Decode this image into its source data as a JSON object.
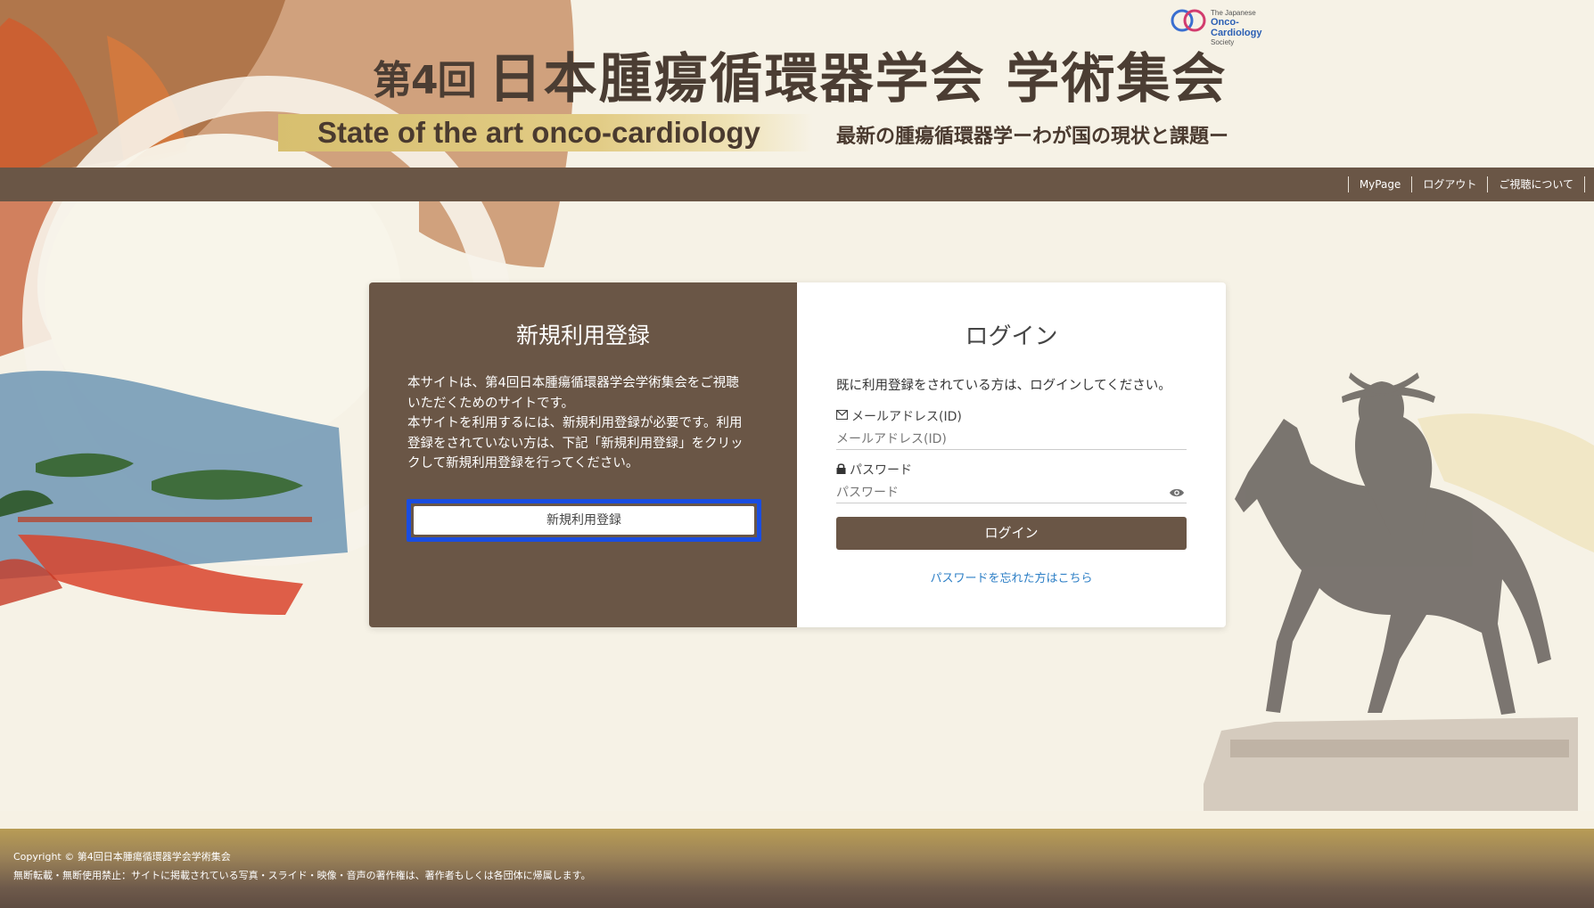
{
  "header": {
    "society_logo": {
      "line1": "The Japanese",
      "line2": "Onco-Cardiology",
      "line3": "Society",
      "icon": "society-ring-logo"
    },
    "title_number": "第4回",
    "title_name": "日本腫瘍循環器学会 学術集会",
    "subtitle_en": "State of the art onco-cardiology",
    "subtitle_jp": "最新の腫瘍循環器学ーわが国の現状と課題ー"
  },
  "nav": {
    "links": [
      "MyPage",
      "ログアウト",
      "ご視聴について"
    ]
  },
  "register": {
    "title": "新規利用登録",
    "body": "本サイトは、第4回日本腫瘍循環器学会学術集会をご視聴いただくためのサイトです。本サイトを利用するには、新規利用登録が必要です。利用登録をされていない方は、下記「新規利用登録」をクリックして新規利用登録を行ってください。",
    "body_lines": [
      "本サイトは、第4回日本腫瘍循環器学会学術集会をご視聴",
      "いただくためのサイトです。",
      "本サイトを利用するには、新規利用登録が必要です。利用",
      "登録をされていない方は、下記「新規利用登録」をクリッ",
      "クして新規利用登録を行ってください。"
    ],
    "button_label": "新規利用登録"
  },
  "login": {
    "title": "ログイン",
    "intro": "既に利用登録をされている方は、ログインしてください。",
    "email_label": "メールアドレス(ID)",
    "email_placeholder": "メールアドレス(ID)",
    "password_label": "パスワード",
    "password_placeholder": "パスワード",
    "button_label": "ログイン",
    "forgot_link": "パスワードを忘れた方はこちら",
    "icons": {
      "email": "envelope-icon",
      "password": "lock-icon",
      "toggle": "eye-icon"
    }
  },
  "footer": {
    "copyright": "Copyright © 第4回日本腫瘍循環器学会学術集会",
    "notice": "無断転載・無断使用禁止：サイトに掲載されている写真・スライド・映像・音声の著作権は、著作者もしくは各団体に帰属します。"
  },
  "colors": {
    "brand_brown": "#6a5646",
    "accent_gold": "#d7bf6f",
    "highlight_blue": "#1a4de0",
    "link_blue": "#2d7fc6"
  }
}
